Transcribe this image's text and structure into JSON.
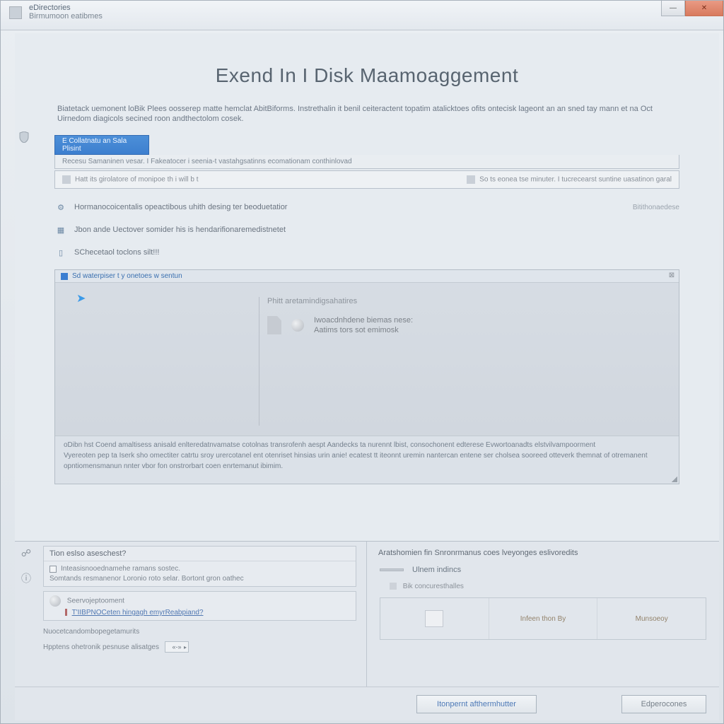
{
  "window": {
    "title_line1": "eDirectories",
    "title_line2": "Birmumoon eatibmes"
  },
  "page": {
    "title": "Exend In I Disk Maamoaggement",
    "intro1": "Biatetack uemonent loBik Plees oosserep matte hemclat AbitBiforms. Instrethalin it benil ceiteractent topatim atalicktoes ofits ontecisk lageont an an sned tay mann et na Oct Uirnedom diagicols secined roon andthectolom cosek.",
    "intro2": ""
  },
  "step": {
    "badge": "E Collatnatu an Sala Plisint",
    "sub": "Recesu Samaninen vesar. I Fakeatocer i seenia-t vastahgsatinns ecomationam conthinlovad",
    "box_left": "Hatt its girolatore of monipoe th i will b t",
    "box_right": "So ts eonea tse minuter. I tucrecearst suntine uasatinon garal"
  },
  "list": [
    {
      "label": "Hormanocoicentalis opeactibous uhith desing ter beoduetatior",
      "right": "Bitithonaedese"
    },
    {
      "label": "Jbon ande Uectover somider his is hendarifionaremedistnetet",
      "right": ""
    },
    {
      "label": "SChecetaol toclons silt!!!",
      "right": ""
    }
  ],
  "panel": {
    "tab": "Sd waterpiser t y onetoes w sentun",
    "heading": "Phitt aretamindigsahatires",
    "line1": "Iwoacdnhdene biemas nese:",
    "line2": "Aatims tors sot emimosk",
    "footer1": "oDibn hst Coend amaltisess anisald enlteredatnvamatse cotolnas transrofenh aespt Aandecks ta nurennt lbist, consochonent edterese Evwortoanadts elstvilvampoorment",
    "footer2": "Vyereoten pep ta Iserk sho omectiter catrtu sroy urercotanel ent otenriset hinsias urin anie! ecatest tt iteonnt uremin nantercan entene ser cholsea sooreed otteverk themnat of otremanent",
    "footer3": "opntiomensmanun nnter vbor fon onstrorbart coen enrtemanut ibimim."
  },
  "bottom": {
    "left": {
      "sect1_title": "Tion eslso aseschest?",
      "chk1": "Inteasisnooednamehe ramans sostec.",
      "chk2": "Somtands resmanenor Loronio roto selar. Bortont gron oathec",
      "sect2_title": "Seervojeptooment",
      "sect2_line": "T'IIBPNOCeten hingagh emyrReabpiand?",
      "row3": "Nuocetcandombopegetamurits",
      "row4": "Hpptens ohetronik pesnuse alisatges"
    },
    "right": {
      "heading": "Aratshomien fin Snronrmanus coes lveyonges eslivoredits",
      "big": "Ulnem indincs",
      "sub": "Bik concuresthalles",
      "card_mid": "Infeen thon By",
      "card_right": "Munsoeoy"
    },
    "buttons": {
      "primary": "Itonpernt afthermhutter",
      "secondary": "Edperocones"
    }
  }
}
